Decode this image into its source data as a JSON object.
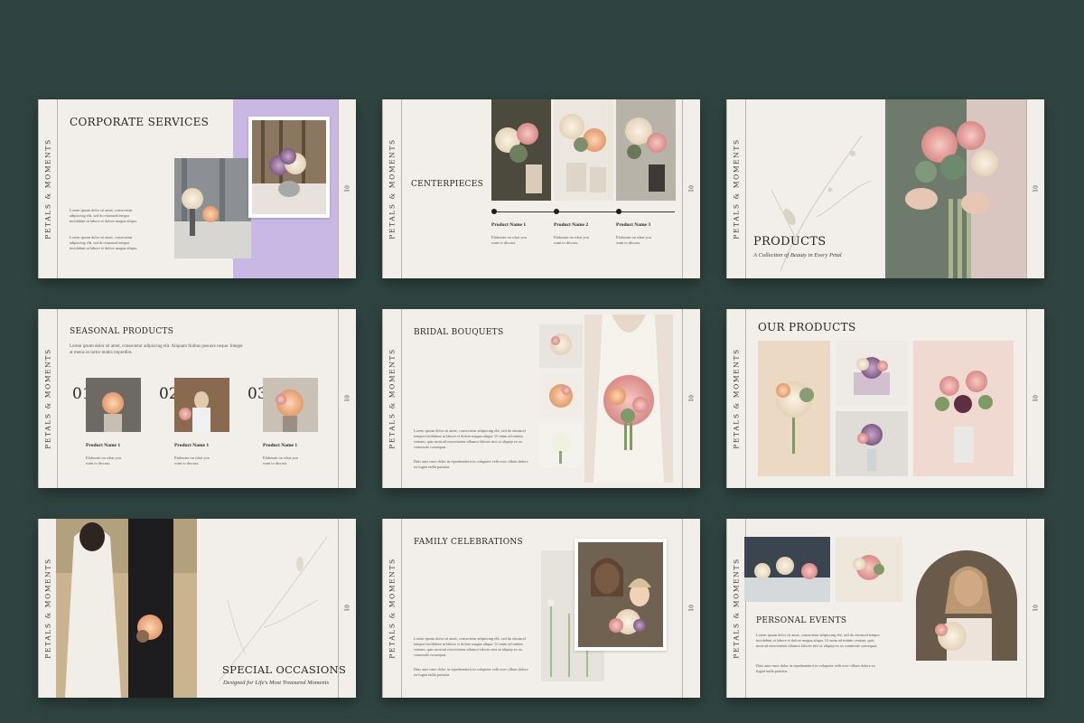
{
  "brand": "PETALS & MOMENTS",
  "page_number": "01",
  "slides": {
    "corporate": {
      "title": "CORPORATE SERVICES",
      "para1": "Lorem ipsum dolor sit amet, consectetur adipiscing elit, sed do eiusmod tempor incididunt ut labore et dolore magna aliqua.",
      "para2": "Lorem ipsum dolor sit amet, consectetur adipiscing elit, sed do eiusmod tempor incididunt ut labore et dolore magna aliqua.",
      "accent": "#c9b8e3"
    },
    "centerpieces": {
      "title": "CENTERPIECES",
      "products": [
        {
          "name": "Product Name 1",
          "desc": "Elaborate on what you want to discuss."
        },
        {
          "name": "Product Name 2",
          "desc": "Elaborate on what you want to discuss."
        },
        {
          "name": "Product Name 3",
          "desc": "Elaborate on what you want to discuss."
        }
      ]
    },
    "products": {
      "title": "PRODUCTS",
      "subtitle": "A Collection of Beauty in Every Petal"
    },
    "seasonal": {
      "title": "SEASONAL PRODUCTS",
      "intro": "Lorem ipsum dolor sit amet, consectetur adipiscing elit. Aliquam finibus posuere neque. Integer at metus ut tortor mattis imperdiet.",
      "items": [
        {
          "num": "01",
          "name": "Product Name 1",
          "desc": "Elaborate on what you want to discuss."
        },
        {
          "num": "02",
          "name": "Product Name 1",
          "desc": "Elaborate on what you want to discuss."
        },
        {
          "num": "03",
          "name": "Product Name 1",
          "desc": "Elaborate on what you want to discuss."
        }
      ]
    },
    "bridal": {
      "title": "BRIDAL BOUQUETS",
      "para1": "Lorem ipsum dolor sit amet, consectetur adipiscing elit, sed do eiusmod tempor incididunt ut labore et dolore magna aliqua. Ut enim ad minim veniam, quis nostrud exercitation ullamco laboris nisi ut aliquip ex ea commodo consequat.",
      "para2": "Duis aute irure dolor in reprehenderit in voluptate velit esse cillum dolore eu fugiat nulla pariatur."
    },
    "our_products": {
      "title": "OUR PRODUCTS"
    },
    "special": {
      "title": "SPECIAL OCCASIONS",
      "subtitle": "Designed for Life's Most Treasured Moments"
    },
    "family": {
      "title": "FAMILY CELEBRATIONS",
      "para1": "Lorem ipsum dolor sit amet, consectetur adipiscing elit, sed do eiusmod tempor incididunt ut labore et dolore magna aliqua. Ut enim ad minim veniam, quis nostrud exercitation ullamco laboris nisi ut aliquip ex ea commodo consequat.",
      "para2": "Duis aute irure dolor in reprehenderit in voluptate velit esse cillum dolore eu fugiat nulla pariatur."
    },
    "personal": {
      "title": "PERSONAL EVENTS",
      "para1": "Lorem ipsum dolor sit amet, consectetur adipiscing elit, sed do eiusmod tempor incididunt ut labore et dolore magna aliqua. Ut enim ad minim veniam, quis nostrud exercitation ullamco laboris nisi ut aliquip ex ea commodo consequat.",
      "para2": "Duis aute irure dolor in reprehenderit in voluptate velit esse cillum dolore eu fugiat nulla pariatur."
    }
  }
}
